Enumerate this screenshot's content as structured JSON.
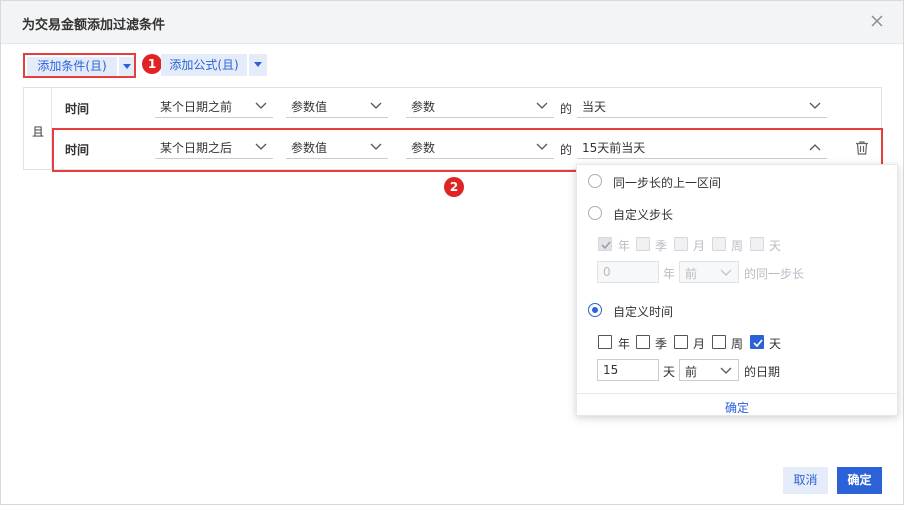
{
  "dialog": {
    "title": "为交易金额添加过滤条件",
    "close_icon": "close-icon"
  },
  "toolbar": {
    "add_condition_label": "添加条件(且)",
    "add_formula_label": "添加公式(且)",
    "badge1": "1",
    "badge2": "2"
  },
  "conditions": {
    "and_label": "且",
    "rows": [
      {
        "field": "时间",
        "operator": "某个日期之前",
        "value_type": "参数值",
        "param": "参数",
        "de": "的",
        "value": "当天"
      },
      {
        "field": "时间",
        "operator": "某个日期之后",
        "value_type": "参数值",
        "param": "参数",
        "de": "的",
        "value": "15天前当天"
      }
    ]
  },
  "popover": {
    "option_prev_period": "同一步长的上一区间",
    "option_custom_step": "自定义步长",
    "step_units": [
      "年",
      "季",
      "月",
      "周",
      "天"
    ],
    "step_input_value": "0",
    "step_unit_label": "年",
    "step_direction": "前",
    "step_suffix": "的同一步长",
    "option_custom_time": "自定义时间",
    "time_units": [
      "年",
      "季",
      "月",
      "周",
      "天"
    ],
    "time_input_value": "15",
    "time_unit_label": "天",
    "time_direction": "前",
    "time_suffix": "的日期",
    "confirm_label": "确定"
  },
  "footer": {
    "cancel_label": "取消",
    "ok_label": "确定"
  },
  "colors": {
    "accent": "#2c62d8",
    "highlight": "#e63d3d",
    "badge": "#e02424"
  }
}
